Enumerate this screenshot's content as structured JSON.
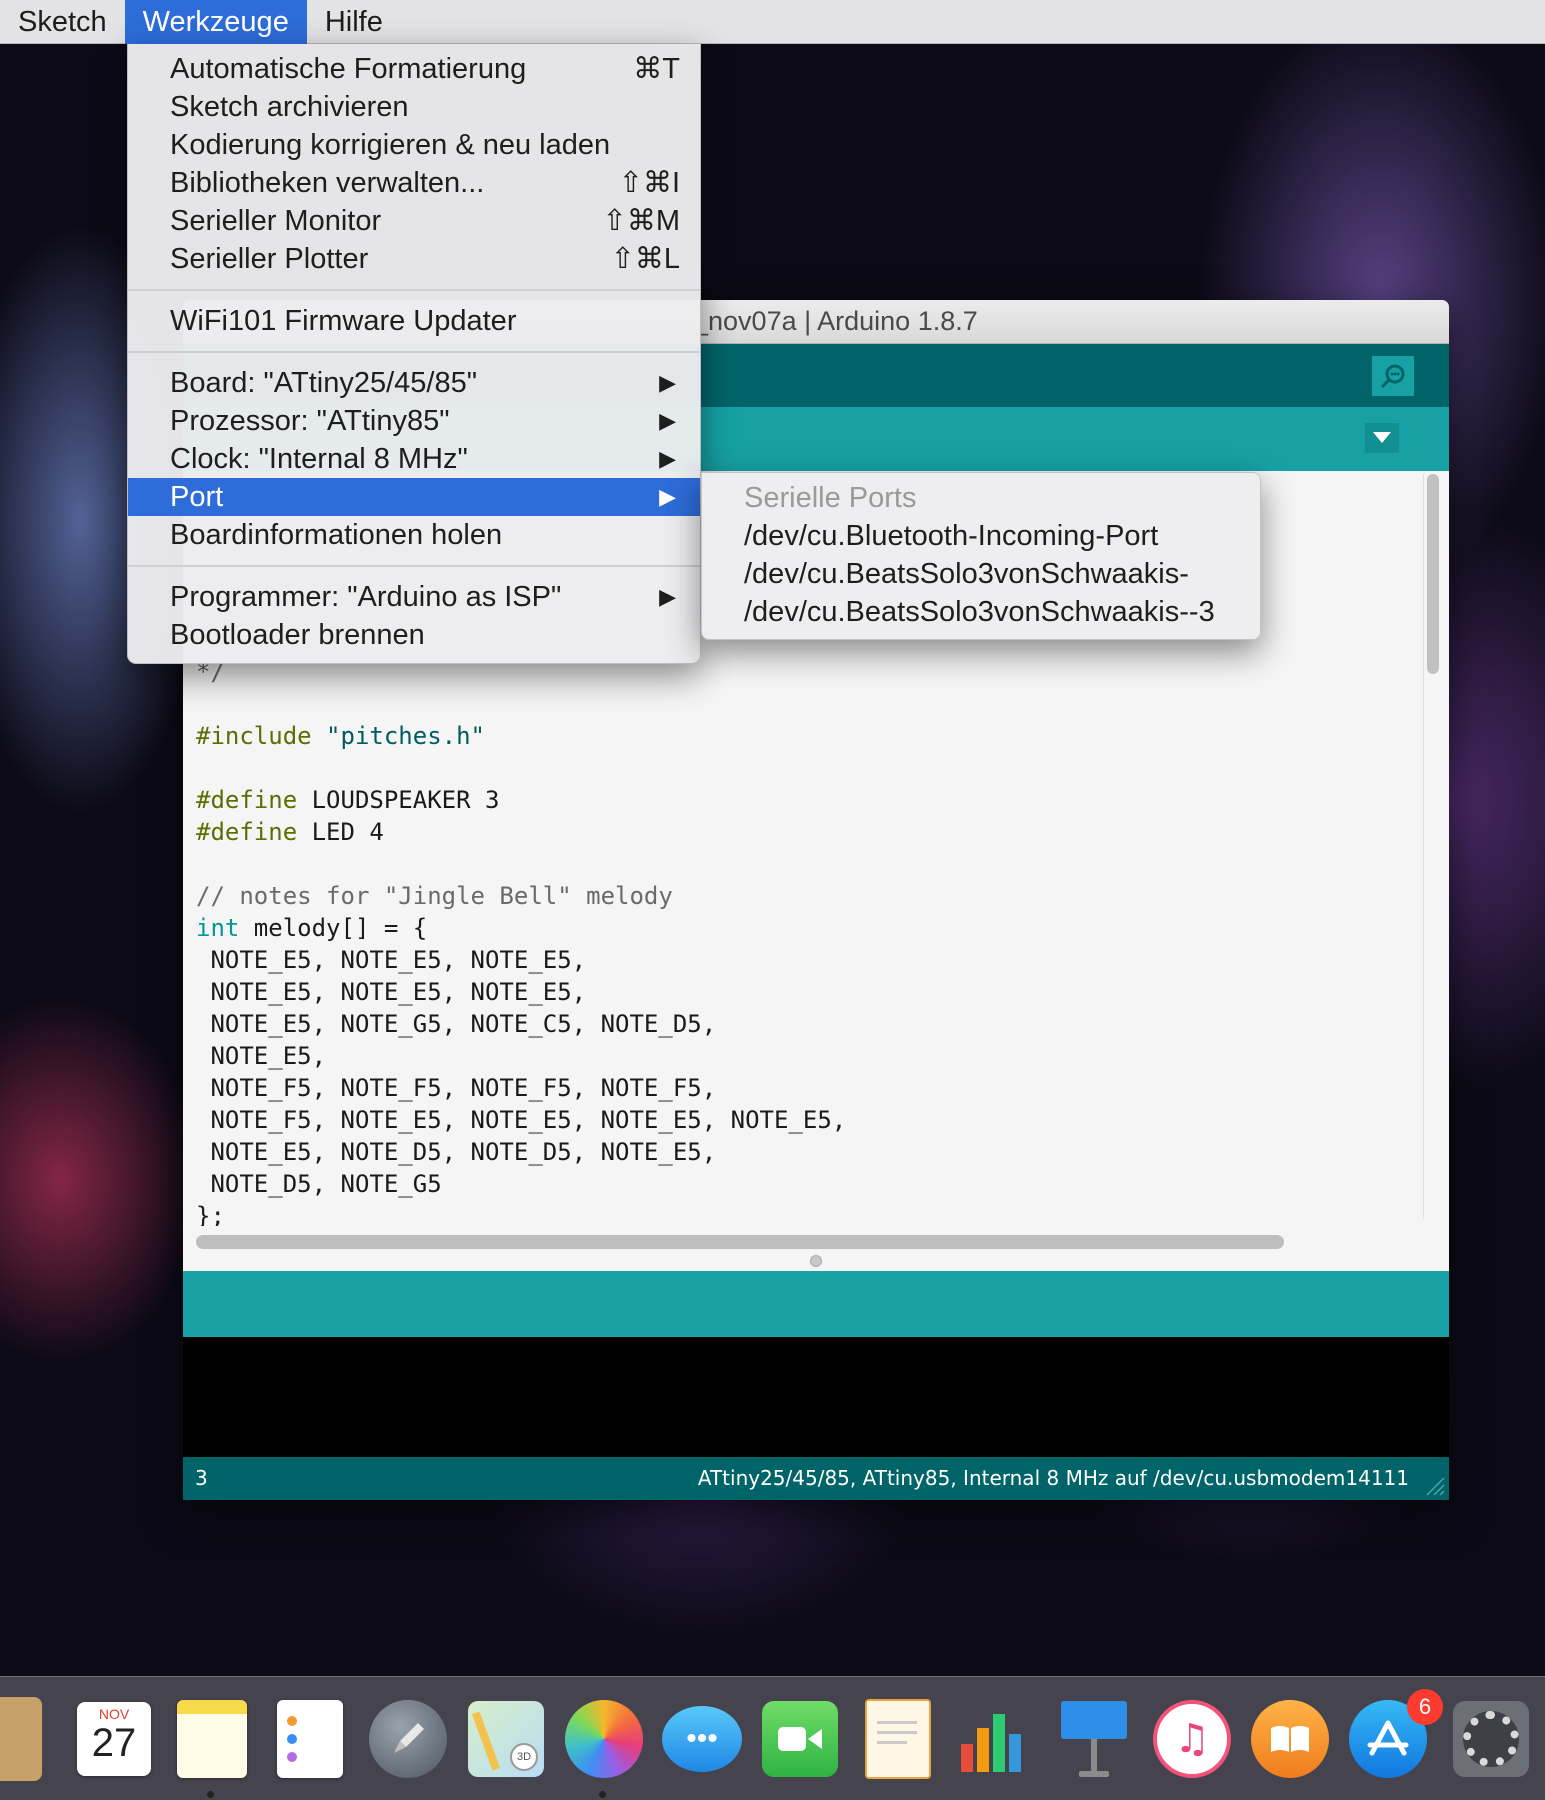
{
  "menubar": {
    "items": [
      {
        "label": "Sketch",
        "active": false
      },
      {
        "label": "Werkzeuge",
        "active": true
      },
      {
        "label": "Hilfe",
        "active": false
      }
    ]
  },
  "window": {
    "title": "_nov07a | Arduino 1.8.7",
    "status_line": "3",
    "status_board": "ATtiny25/45/85, ATtiny85, Internal 8 MHz auf /dev/cu.usbmodem14111"
  },
  "code": {
    "comment_end": "*/",
    "include_dir": "#include",
    "include_file": "\"pitches.h\"",
    "define_dir": "#define",
    "define1": " LOUDSPEAKER 3",
    "define2": " LED 4",
    "comment_notes": "// notes for \"Jingle Bell\" melody",
    "int_kw": "int",
    "melody_decl": " melody[] = {",
    "line1": " NOTE_E5, NOTE_E5, NOTE_E5,",
    "line2": " NOTE_E5, NOTE_E5, NOTE_E5,",
    "line3": " NOTE_E5, NOTE_G5, NOTE_C5, NOTE_D5,",
    "line4": " NOTE_E5,",
    "line5": " NOTE_F5, NOTE_F5, NOTE_F5, NOTE_F5,",
    "line6": " NOTE_F5, NOTE_E5, NOTE_E5, NOTE_E5, NOTE_E5,",
    "line7": " NOTE_E5, NOTE_D5, NOTE_D5, NOTE_E5,",
    "line8": " NOTE_D5, NOTE_G5",
    "line9": "};"
  },
  "tools_menu": {
    "auto_format": {
      "label": "Automatische Formatierung",
      "shortcut": "⌘T"
    },
    "archive": {
      "label": "Sketch archivieren"
    },
    "fix_encoding": {
      "label": "Kodierung korrigieren & neu laden"
    },
    "libraries": {
      "label": "Bibliotheken verwalten...",
      "shortcut": "⇧⌘I"
    },
    "serial_monitor": {
      "label": "Serieller Monitor",
      "shortcut": "⇧⌘M"
    },
    "serial_plotter": {
      "label": "Serieller Plotter",
      "shortcut": "⇧⌘L"
    },
    "wifi_updater": {
      "label": "WiFi101 Firmware Updater"
    },
    "board": {
      "label": "Board: \"ATtiny25/45/85\""
    },
    "processor": {
      "label": "Prozessor: \"ATtiny85\""
    },
    "clock": {
      "label": "Clock: \"Internal 8 MHz\""
    },
    "port": {
      "label": "Port"
    },
    "board_info": {
      "label": "Boardinformationen holen"
    },
    "programmer": {
      "label": "Programmer: \"Arduino as ISP\""
    },
    "bootloader": {
      "label": "Bootloader brennen"
    },
    "arrow": "▶"
  },
  "port_submenu": {
    "header": "Serielle Ports",
    "ports": [
      "/dev/cu.Bluetooth-Incoming-Port",
      "/dev/cu.BeatsSolo3vonSchwaakis-",
      "/dev/cu.BeatsSolo3vonSchwaakis--3"
    ]
  },
  "dock": {
    "calendar_month": "NOV",
    "calendar_day": "27",
    "appstore_badge": "6",
    "icons": [
      "contacts-icon",
      "calendar-icon",
      "notes-icon",
      "reminders-icon",
      "launchpad-icon",
      "maps-icon",
      "photos-icon",
      "messages-icon",
      "facetime-icon",
      "pages-icon",
      "numbers-icon",
      "keynote-icon",
      "itunes-icon",
      "ibooks-icon",
      "appstore-icon",
      "system-preferences-icon"
    ]
  },
  "colors": {
    "arduino_dark": "#006468",
    "arduino_teal": "#17a1a5",
    "menu_highlight": "#2d6cd9"
  }
}
